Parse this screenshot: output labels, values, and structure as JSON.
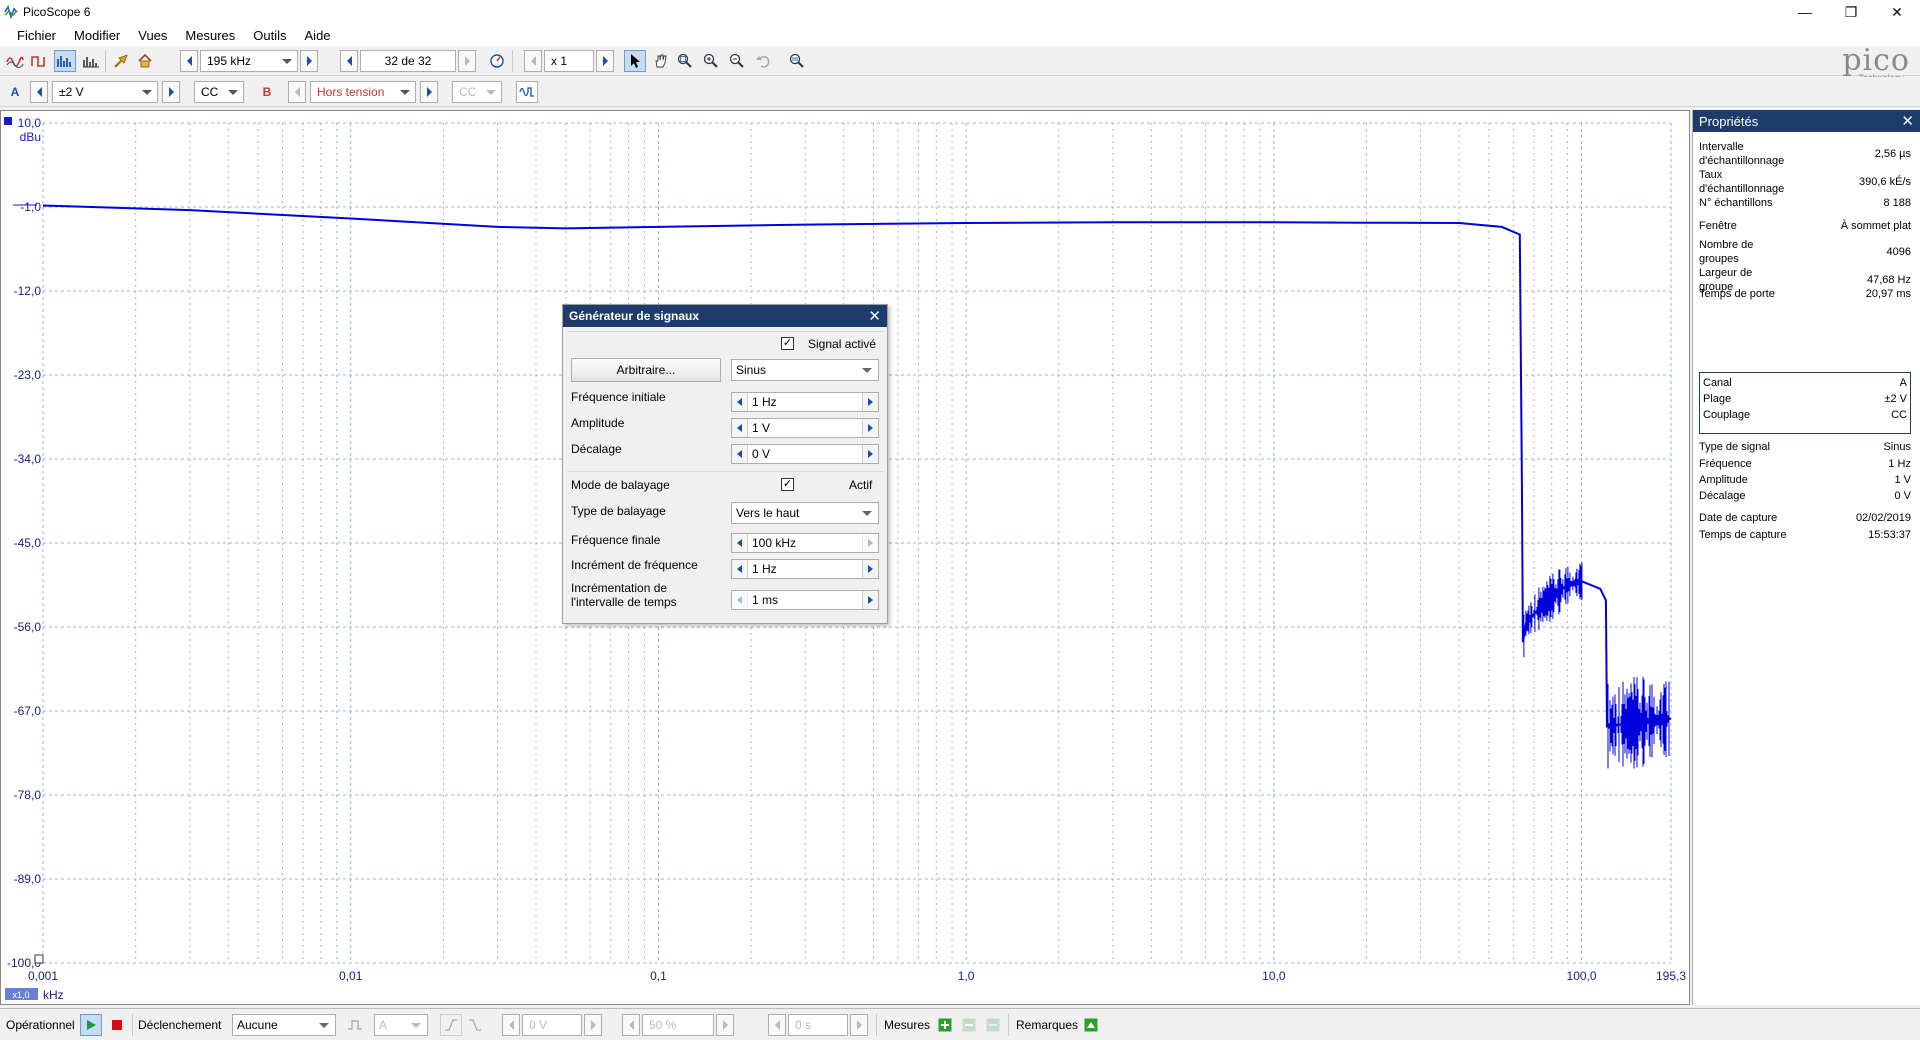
{
  "window": {
    "title": "PicoScope 6"
  },
  "menu": [
    "Fichier",
    "Modifier",
    "Vues",
    "Mesures",
    "Outils",
    "Aide"
  ],
  "toolbar": {
    "timebase": "195 kHz",
    "capture_count": "32 de 32",
    "zoom_factor": "x 1",
    "logo_text": "pico",
    "logo_sub": "Technology"
  },
  "channel_bar": {
    "a_label": "A",
    "a_range": "±2 V",
    "a_coupling": "CC",
    "b_label": "B",
    "b_range": "Hors tension",
    "b_coupling": "CC"
  },
  "chart_data": {
    "type": "line",
    "title": "",
    "xlabel": "kHz",
    "ylabel": "dBu",
    "x_scale": "log",
    "xlim": [
      0.001,
      195.3
    ],
    "ylim": [
      -100.0,
      10.0
    ],
    "x_ticks": [
      "0,001",
      "0,01",
      "0,1",
      "1,0",
      "10,0",
      "100,0",
      "195,3"
    ],
    "y_ticks": [
      "10,0",
      "-1,0",
      "-12,0",
      "-23,0",
      "-34,0",
      "-45,0",
      "-56,0",
      "-67,0",
      "-78,0",
      "-89,0",
      "-100,0"
    ],
    "x_zoom_label": "x1,0",
    "grid": true,
    "series": [
      {
        "color": "#0000dd",
        "x": [
          0.001,
          0.003,
          0.01,
          0.03,
          0.05,
          0.1,
          0.3,
          1.0,
          3.0,
          10.0,
          20.0,
          40.0,
          55.0,
          63.0,
          64.0,
          64.5,
          66.0,
          75.0,
          90.0,
          100.0,
          115.0,
          120.0,
          121.0,
          150.0,
          195.3
        ],
        "y": [
          -0.8,
          -1.4,
          -2.5,
          -3.6,
          -3.8,
          -3.6,
          -3.3,
          -3.1,
          -3.0,
          -3.0,
          -3.05,
          -3.1,
          -3.6,
          -4.6,
          -37.0,
          -58.0,
          -55.5,
          -53.0,
          -50.5,
          -50.0,
          -51.0,
          -52.5,
          -69.0,
          -68.5,
          -68.0
        ]
      }
    ]
  },
  "signal_generator": {
    "title": "Générateur de signaux",
    "signal_active_label": "Signal activé",
    "signal_active": true,
    "arbitrary_button": "Arbitraire...",
    "waveform": "Sinus",
    "start_freq_label": "Fréquence initiale",
    "start_freq": "1 Hz",
    "amplitude_label": "Amplitude",
    "amplitude": "1 V",
    "offset_label": "Décalage",
    "offset": "0 V",
    "sweep_mode_label": "Mode de balayage",
    "sweep_active_label": "Actif",
    "sweep_active": true,
    "sweep_type_label": "Type de balayage",
    "sweep_type": "Vers le haut",
    "stop_freq_label": "Fréquence finale",
    "stop_freq": "100 kHz",
    "freq_increment_label": "Incrément de fréquence",
    "freq_increment": "1 Hz",
    "time_increment_label_1": "Incrémentation de",
    "time_increment_label_2": "l'intervalle de temps",
    "time_increment": "1 ms"
  },
  "properties": {
    "title": "Propriétés",
    "rows1": [
      {
        "k1": "Intervalle",
        "k2": "d'échantillonnage",
        "v": "2,56 µs"
      },
      {
        "k1": "Taux",
        "k2": "d'échantillonnage",
        "v": "390,6 kÉ/s"
      },
      {
        "k1": "N° échantillons",
        "k2": "",
        "v": "8 188"
      }
    ],
    "rows2": [
      {
        "k1": "Fenêtre",
        "k2": "",
        "v": "À sommet plat"
      },
      {
        "k1": "Nombre de",
        "k2": "groupes",
        "v": "4096"
      },
      {
        "k1": "Largeur de",
        "k2": "groupe",
        "v": "47,68 Hz"
      },
      {
        "k1": "Temps de porte",
        "k2": "",
        "v": "20,97 ms"
      }
    ],
    "channel_rows": [
      {
        "k": "Canal",
        "v": "A"
      },
      {
        "k": "Plage",
        "v": "±2 V"
      },
      {
        "k": "Couplage",
        "v": "CC"
      }
    ],
    "rows3": [
      {
        "k": "Type de signal",
        "v": "Sinus"
      },
      {
        "k": "Fréquence",
        "v": "1 Hz"
      },
      {
        "k": "Amplitude",
        "v": "1 V"
      },
      {
        "k": "Décalage",
        "v": "0 V"
      }
    ],
    "rows4": [
      {
        "k": "Date de capture",
        "v": "02/02/2019"
      },
      {
        "k": "Temps de capture",
        "v": "15:53:37"
      }
    ]
  },
  "status": {
    "state": "Opérationnel",
    "trigger_label": "Déclenchement",
    "trigger_mode": "Aucune",
    "trigger_channel": "A",
    "trigger_level": "0 V",
    "trigger_pos": "50 %",
    "trigger_delay": "0 s",
    "measures_label": "Mesures",
    "remarks_label": "Remarques"
  },
  "colors": {
    "accent": "#1d3c6b",
    "trace": "#0000dd",
    "grid": "#8fb8d8"
  }
}
